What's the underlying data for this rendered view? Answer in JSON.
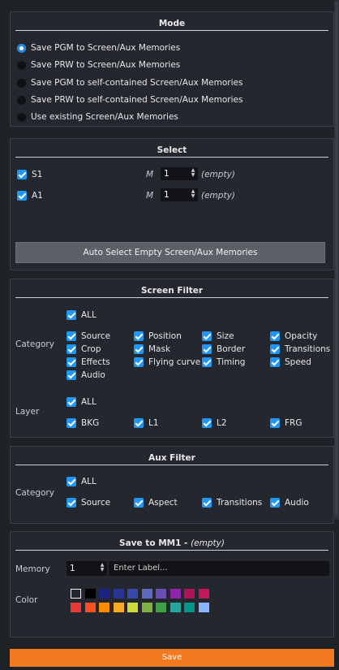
{
  "mode": {
    "title": "Mode",
    "options": [
      {
        "label": "Save PGM to Screen/Aux Memories",
        "checked": true
      },
      {
        "label": "Save PRW to Screen/Aux Memories",
        "checked": false
      },
      {
        "label": "Save PGM to self-contained Screen/Aux Memories",
        "checked": false
      },
      {
        "label": "Save PRW to self-contained Screen/Aux Memories",
        "checked": false
      },
      {
        "label": "Use existing Screen/Aux Memories",
        "checked": false
      }
    ]
  },
  "select": {
    "title": "Select",
    "rows": [
      {
        "label": "S1",
        "m_label": "M",
        "value": "1",
        "status": "(empty)"
      },
      {
        "label": "A1",
        "m_label": "M",
        "value": "1",
        "status": "(empty)"
      }
    ],
    "auto_button": "Auto Select Empty Screen/Aux Memories"
  },
  "screen_filter": {
    "title": "Screen Filter",
    "category_label": "Category",
    "all_label": "ALL",
    "categories": [
      "Source",
      "Position",
      "Size",
      "Opacity",
      "Crop",
      "Mask",
      "Border",
      "Transitions",
      "Effects",
      "Flying curve",
      "Timing",
      "Speed",
      "Audio"
    ],
    "layer_label": "Layer",
    "layer_all": "ALL",
    "layers": [
      "BKG",
      "L1",
      "L2",
      "FRG"
    ]
  },
  "aux_filter": {
    "title": "Aux Filter",
    "category_label": "Category",
    "all_label": "ALL",
    "categories": [
      "Source",
      "Aspect",
      "Transitions",
      "Audio"
    ]
  },
  "save_to": {
    "title": "Save to MM1 -",
    "title_status": "(empty)",
    "memory_label": "Memory",
    "memory_value": "1",
    "label_placeholder": "Enter Label...",
    "color_label": "Color",
    "colors_row1": [
      "#f2f2f2",
      "#000000",
      "#1a237e",
      "#283593",
      "#3949ab",
      "#5c6bc0",
      "#6a4fb0",
      "#8e24aa",
      "#ad1457",
      "#c2185b"
    ],
    "colors_row2": [
      "#e53935",
      "#f4511e",
      "#fb8c00",
      "#f9a825",
      "#cddc39",
      "#7cb342",
      "#43a047",
      "#26a69a",
      "#009688",
      "#8ab4f8"
    ]
  },
  "save_button": "Save"
}
